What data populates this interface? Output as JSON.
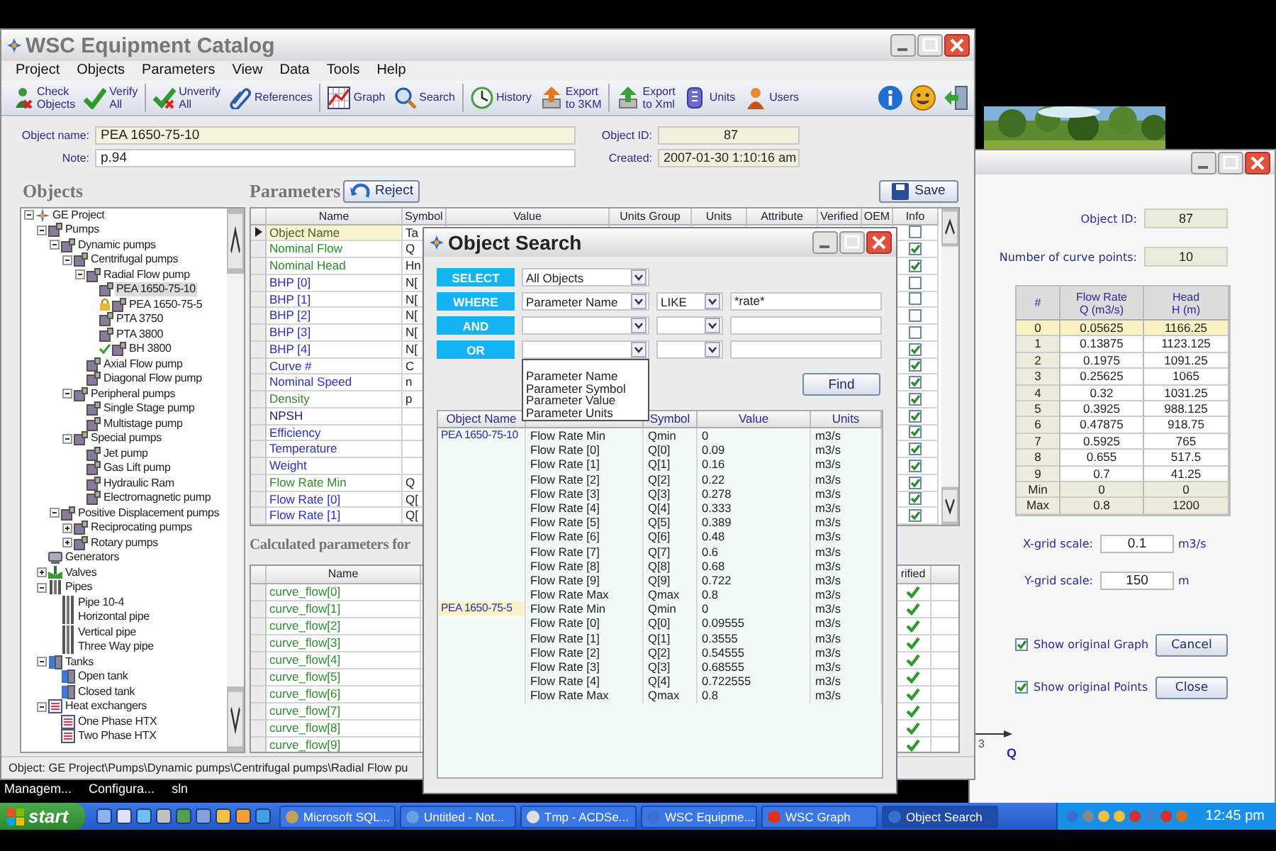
{
  "desktop": {
    "icon_labels": [
      "Managem...",
      "Configura...",
      "sln"
    ]
  },
  "main_window": {
    "title": "WSC Equipment Catalog",
    "menu": [
      "Project",
      "Objects",
      "Parameters",
      "View",
      "Data",
      "Tools",
      "Help"
    ],
    "toolbar": [
      {
        "kind": "check-objects",
        "lines": [
          "Check",
          "Objects"
        ]
      },
      {
        "kind": "verify",
        "lines": [
          "Verify",
          "All"
        ]
      },
      {
        "kind": "unverify",
        "lines": [
          "Unverify",
          "All"
        ]
      },
      {
        "kind": "references",
        "lines": [
          "References"
        ]
      },
      {
        "kind": "graph",
        "lines": [
          "Graph"
        ]
      },
      {
        "kind": "search",
        "lines": [
          "Search"
        ]
      },
      {
        "kind": "history",
        "lines": [
          "History"
        ]
      },
      {
        "kind": "export-3km",
        "lines": [
          "Export",
          "to 3KM"
        ]
      },
      {
        "kind": "export-xml",
        "lines": [
          "Export",
          "to Xml"
        ]
      },
      {
        "kind": "units",
        "lines": [
          "Units"
        ]
      },
      {
        "kind": "users",
        "lines": [
          "Users"
        ]
      }
    ],
    "toolbar_right": [
      {
        "kind": "info"
      },
      {
        "kind": "smiley"
      },
      {
        "kind": "exit"
      }
    ],
    "fields": {
      "object_name_label": "Object name:",
      "object_name": "PEA 1650-75-10",
      "note_label": "Note:",
      "note": "p.94",
      "object_id_label": "Object ID:",
      "object_id": "87",
      "created_label": "Created:",
      "created": "2007-01-30 1:10:16 am"
    },
    "objects": {
      "title": "Objects",
      "tree": [
        {
          "label": "GE Project",
          "kind": "project",
          "expanded": true,
          "selected": false,
          "children": [
            {
              "label": "Pumps",
              "kind": "pump",
              "expanded": true,
              "selected": false,
              "children": [
                {
                  "label": "Dynamic pumps",
                  "kind": "pump",
                  "expanded": true,
                  "selected": false,
                  "children": [
                    {
                      "label": "Centrifugal pumps",
                      "kind": "pump",
                      "expanded": true,
                      "selected": false,
                      "children": [
                        {
                          "label": "Radial Flow pump",
                          "kind": "pump",
                          "expanded": true,
                          "selected": false,
                          "children": [
                            {
                              "label": "PEA 1650-75-10",
                              "kind": "pump",
                              "locked": false,
                              "verified": false,
                              "selected": true
                            },
                            {
                              "label": "PEA 1650-75-5",
                              "kind": "pump",
                              "locked": true,
                              "verified": false,
                              "selected": false
                            },
                            {
                              "label": "PTA 3750",
                              "kind": "pump",
                              "locked": false,
                              "verified": false,
                              "selected": false
                            },
                            {
                              "label": "PTA 3800",
                              "kind": "pump",
                              "locked": false,
                              "verified": false,
                              "selected": false
                            },
                            {
                              "label": "BH 3800",
                              "kind": "pump",
                              "locked": false,
                              "verified": true,
                              "selected": false
                            }
                          ]
                        },
                        {
                          "label": "Axial Flow pump",
                          "kind": "pump",
                          "selected": false
                        },
                        {
                          "label": "Diagonal Flow pump",
                          "kind": "pump",
                          "selected": false
                        }
                      ]
                    },
                    {
                      "label": "Peripheral pumps",
                      "kind": "pump",
                      "expanded": true,
                      "selected": false,
                      "children": [
                        {
                          "label": "Single Stage pump",
                          "kind": "pump",
                          "selected": false
                        },
                        {
                          "label": "Multistage pump",
                          "kind": "pump",
                          "selected": false
                        }
                      ]
                    },
                    {
                      "label": "Special pumps",
                      "kind": "pump",
                      "expanded": true,
                      "selected": false,
                      "children": [
                        {
                          "label": "Jet pump",
                          "kind": "pump",
                          "selected": false
                        },
                        {
                          "label": "Gas Lift pump",
                          "kind": "pump",
                          "selected": false
                        },
                        {
                          "label": "Hydraulic Ram",
                          "kind": "pump",
                          "selected": false
                        },
                        {
                          "label": "Electromagnetic pump",
                          "kind": "pump",
                          "selected": false
                        }
                      ]
                    }
                  ]
                },
                {
                  "label": "Positive Displacement pumps",
                  "kind": "pump",
                  "expanded": true,
                  "selected": false,
                  "children": [
                    {
                      "label": "Reciprocating pumps",
                      "kind": "pump",
                      "expanded": false,
                      "selected": false
                    },
                    {
                      "label": "Rotary pumps",
                      "kind": "pump",
                      "expanded": false,
                      "selected": false
                    }
                  ]
                }
              ]
            },
            {
              "label": "Generators",
              "kind": "generator",
              "selected": false
            },
            {
              "label": "Valves",
              "kind": "valve",
              "expanded": false,
              "selected": false
            },
            {
              "label": "Pipes",
              "kind": "pipe",
              "expanded": true,
              "selected": false,
              "children": [
                {
                  "label": "Pipe 10-4",
                  "kind": "pipe",
                  "selected": false
                },
                {
                  "label": "Horizontal pipe",
                  "kind": "pipe",
                  "selected": false
                },
                {
                  "label": "Vertical pipe",
                  "kind": "pipe",
                  "selected": false
                },
                {
                  "label": "Three Way pipe",
                  "kind": "pipe",
                  "selected": false
                }
              ]
            },
            {
              "label": "Tanks",
              "kind": "tank",
              "expanded": true,
              "selected": false,
              "children": [
                {
                  "label": "Open tank",
                  "kind": "tank",
                  "selected": false
                },
                {
                  "label": "Closed tank",
                  "kind": "tank",
                  "selected": false
                }
              ]
            },
            {
              "label": "Heat exchangers",
              "kind": "exchanger",
              "expanded": true,
              "selected": false,
              "children": [
                {
                  "label": "One Phase HTX",
                  "kind": "exchanger",
                  "selected": false
                },
                {
                  "label": "Two Phase HTX",
                  "kind": "exchanger",
                  "selected": false
                }
              ]
            }
          ]
        }
      ]
    },
    "parameters": {
      "title": "Parameters",
      "reject_button": "Reject",
      "save_button": "Save",
      "columns": [
        "Name",
        "Symbol",
        "Value",
        "Units Group",
        "Units",
        "Attribute",
        "Verified",
        "OEM",
        "Info"
      ],
      "rows": [
        {
          "name": "Object Name",
          "symbol": "Ta",
          "color": "#4a5a3a",
          "info": false,
          "selected": true
        },
        {
          "name": "Nominal Flow",
          "symbol": "Q",
          "color": "#2e8b2e",
          "info": true,
          "selected": false
        },
        {
          "name": "Nominal Head",
          "symbol": "Hn",
          "color": "#2e8b2e",
          "info": true,
          "selected": false
        },
        {
          "name": "BHP [0]",
          "symbol": "N[",
          "color": "#2c2cb8",
          "info": false,
          "selected": false
        },
        {
          "name": "BHP [1]",
          "symbol": "N[",
          "color": "#2c2cb8",
          "info": false,
          "selected": false
        },
        {
          "name": "BHP [2]",
          "symbol": "N[",
          "color": "#2c2cb8",
          "info": false,
          "selected": false
        },
        {
          "name": "BHP [3]",
          "symbol": "N[",
          "color": "#2c2cb8",
          "info": false,
          "selected": false
        },
        {
          "name": "BHP [4]",
          "symbol": "N[",
          "color": "#2c2cb8",
          "info": true,
          "selected": false
        },
        {
          "name": "Curve #",
          "symbol": "C",
          "color": "#2c2cd8",
          "info": true,
          "selected": false
        },
        {
          "name": "Nominal Speed",
          "symbol": "n",
          "color": "#2c2cd8",
          "info": true,
          "selected": false
        },
        {
          "name": "Density",
          "symbol": "p",
          "color": "#2e8b2e",
          "info": true,
          "selected": false
        },
        {
          "name": "NPSH",
          "symbol": "",
          "color": "#20206a",
          "info": true,
          "selected": false
        },
        {
          "name": "Efficiency",
          "symbol": "",
          "color": "#2c2cd8",
          "info": true,
          "selected": false
        },
        {
          "name": "Temperature",
          "symbol": "",
          "color": "#2c2cd8",
          "info": true,
          "selected": false
        },
        {
          "name": "Weight",
          "symbol": "",
          "color": "#2c2cd8",
          "info": true,
          "selected": false
        },
        {
          "name": "Flow Rate Min",
          "symbol": "Q",
          "color": "#2e8b2e",
          "info": true,
          "selected": false
        },
        {
          "name": "Flow Rate [0]",
          "symbol": "Q[",
          "color": "#2c2cd8",
          "info": true,
          "selected": false
        },
        {
          "name": "Flow Rate [1]",
          "symbol": "Q[",
          "color": "#2c2cd8",
          "info": true,
          "selected": false
        }
      ]
    },
    "calculated": {
      "title": "Calculated parameters for",
      "columns": [
        "Name",
        "rified"
      ],
      "rows": [
        {
          "name": "curve_flow[0]",
          "verified": true
        },
        {
          "name": "curve_flow[1]",
          "verified": true
        },
        {
          "name": "curve_flow[2]",
          "verified": true
        },
        {
          "name": "curve_flow[3]",
          "verified": true
        },
        {
          "name": "curve_flow[4]",
          "verified": true
        },
        {
          "name": "curve_flow[5]",
          "verified": true
        },
        {
          "name": "curve_flow[6]",
          "verified": true
        },
        {
          "name": "curve_flow[7]",
          "verified": true
        },
        {
          "name": "curve_flow[8]",
          "verified": true
        },
        {
          "name": "curve_flow[9]",
          "verified": true
        }
      ]
    },
    "status_bar": "Object: GE Project\\Pumps\\Dynamic pumps\\Centrifugal pumps\\Radial Flow pu"
  },
  "search_window": {
    "title": "Object Search",
    "clauses": [
      {
        "kind": "select",
        "keyword": "SELECT",
        "field": "All Objects"
      },
      {
        "kind": "condition",
        "keyword": "WHERE",
        "field": "Parameter Name",
        "operator": "LIKE",
        "value": "*rate*"
      },
      {
        "kind": "condition",
        "keyword": "AND"
      },
      {
        "kind": "condition",
        "keyword": "OR",
        "open_options": [
          "Parameter Name",
          "Parameter Symbol",
          "Parameter Value",
          "Parameter Units"
        ]
      }
    ],
    "find_button": "Find",
    "columns": {
      "column_1": "Object Name",
      "column_3": "Symbol",
      "column_4": "Value",
      "column_5": "Units"
    },
    "groups": [
      {
        "object": "PEA 1650-75-10",
        "selected": false,
        "rows": [
          [
            "Flow Rate Min",
            "Qmin",
            "0",
            "m3/s"
          ],
          [
            "Flow Rate [0]",
            "Q[0]",
            "0.09",
            "m3/s"
          ],
          [
            "Flow Rate [1]",
            "Q[1]",
            "0.16",
            "m3/s"
          ],
          [
            "Flow Rate [2]",
            "Q[2]",
            "0.22",
            "m3/s"
          ],
          [
            "Flow Rate [3]",
            "Q[3]",
            "0.278",
            "m3/s"
          ],
          [
            "Flow Rate [4]",
            "Q[4]",
            "0.333",
            "m3/s"
          ],
          [
            "Flow Rate [5]",
            "Q[5]",
            "0.389",
            "m3/s"
          ],
          [
            "Flow Rate [6]",
            "Q[6]",
            "0.48",
            "m3/s"
          ],
          [
            "Flow Rate [7]",
            "Q[7]",
            "0.6",
            "m3/s"
          ],
          [
            "Flow Rate [8]",
            "Q[8]",
            "0.68",
            "m3/s"
          ],
          [
            "Flow Rate [9]",
            "Q[9]",
            "0.722",
            "m3/s"
          ],
          [
            "Flow Rate Max",
            "Qmax",
            "0.8",
            "m3/s"
          ]
        ]
      },
      {
        "object": "PEA 1650-75-5",
        "selected": true,
        "rows": [
          [
            "Flow Rate Min",
            "Qmin",
            "0",
            "m3/s"
          ],
          [
            "Flow Rate [0]",
            "Q[0]",
            "0.09555",
            "m3/s"
          ],
          [
            "Flow Rate [1]",
            "Q[1]",
            "0.3555",
            "m3/s"
          ],
          [
            "Flow Rate [2]",
            "Q[2]",
            "0.54555",
            "m3/s"
          ],
          [
            "Flow Rate [3]",
            "Q[3]",
            "0.68555",
            "m3/s"
          ],
          [
            "Flow Rate [4]",
            "Q[4]",
            "0.722555",
            "m3/s"
          ],
          [
            "Flow Rate Max",
            "Qmax",
            "0.8",
            "m3/s"
          ]
        ]
      }
    ]
  },
  "graph_window": {
    "object_id_label": "Object ID:",
    "object_id": "87",
    "curve_points_label": "Number of curve points:",
    "curve_points": "10",
    "columns": [
      [
        "#"
      ],
      [
        "Flow Rate",
        "Q (m3/s)"
      ],
      [
        "Head",
        "H (m)"
      ]
    ],
    "rows": [
      {
        "kind": "point",
        "index": "0",
        "flow": "0.05625",
        "head": "1166.25",
        "selected": true
      },
      {
        "kind": "point",
        "index": "1",
        "flow": "0.13875",
        "head": "1123.125",
        "selected": false
      },
      {
        "kind": "point",
        "index": "2",
        "flow": "0.1975",
        "head": "1091.25",
        "selected": false
      },
      {
        "kind": "point",
        "index": "3",
        "flow": "0.25625",
        "head": "1065",
        "selected": false
      },
      {
        "kind": "point",
        "index": "4",
        "flow": "0.32",
        "head": "1031.25",
        "selected": false
      },
      {
        "kind": "point",
        "index": "5",
        "flow": "0.3925",
        "head": "988.125",
        "selected": false
      },
      {
        "kind": "point",
        "index": "6",
        "flow": "0.47875",
        "head": "918.75",
        "selected": false
      },
      {
        "kind": "point",
        "index": "7",
        "flow": "0.5925",
        "head": "765",
        "selected": false
      },
      {
        "kind": "point",
        "index": "8",
        "flow": "0.655",
        "head": "517.5",
        "selected": false
      },
      {
        "kind": "point",
        "index": "9",
        "flow": "0.7",
        "head": "41.25",
        "selected": false
      },
      {
        "kind": "limit",
        "index": "Min",
        "flow": "0",
        "head": "0",
        "selected": false
      },
      {
        "kind": "limit",
        "index": "Max",
        "flow": "0.8",
        "head": "1200",
        "selected": false
      }
    ],
    "scales": [
      {
        "label": "X-grid scale:",
        "value": "0.1",
        "unit": "m3/s"
      },
      {
        "label": "Y-grid scale:",
        "value": "150",
        "unit": "m"
      }
    ],
    "options": [
      {
        "label": "Show original Graph",
        "checked": true,
        "button": "Cancel"
      },
      {
        "label": "Show original Points",
        "checked": true,
        "button": "Close"
      }
    ],
    "axis_label": "Q",
    "tick_label": "3"
  },
  "taskbar": {
    "start": "start",
    "tasks": [
      {
        "label": "Microsoft SQL...",
        "kind": "db",
        "selected": false
      },
      {
        "label": "Untitled - Not...",
        "kind": "notepad",
        "selected": false
      },
      {
        "label": "Tmp - ACDSe...",
        "kind": "viewer",
        "selected": false
      },
      {
        "label": "WSC Equipme...",
        "kind": "app",
        "selected": false
      },
      {
        "label": "WSC Graph",
        "kind": "graph",
        "selected": false
      },
      {
        "label": "Object Search",
        "kind": "app",
        "selected": true
      }
    ],
    "clock": "12:45 pm"
  }
}
